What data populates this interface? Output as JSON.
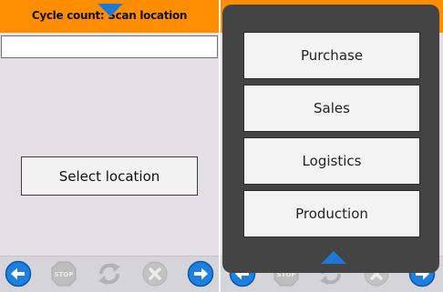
{
  "left_screen": {
    "title": "Cycle count: Scan location",
    "title_arrow_icon": "triangle-down-icon",
    "scan_input": {
      "value": "",
      "placeholder": ""
    },
    "select_location_label": "Select location"
  },
  "right_screen": {
    "menu_items": [
      {
        "label": "Purchase"
      },
      {
        "label": "Sales"
      },
      {
        "label": "Logistics"
      },
      {
        "label": "Production"
      }
    ],
    "menu_arrow_icon": "triangle-up-icon"
  },
  "toolbar": {
    "buttons": [
      {
        "icon": "arrow-left-icon",
        "label": ""
      },
      {
        "icon": "stop-icon",
        "label": "STOP",
        "enabled": false
      },
      {
        "icon": "refresh-icon",
        "label": "",
        "enabled": false
      },
      {
        "icon": "cancel-icon",
        "label": "",
        "enabled": false
      },
      {
        "icon": "arrow-right-icon",
        "label": ""
      }
    ]
  },
  "colors": {
    "title_bar": "#fe8e00",
    "accent_blue": "#1e79d6",
    "background": "#e2e0e5",
    "menu_overlay": "#444444",
    "button_face": "#f2f2f2"
  }
}
